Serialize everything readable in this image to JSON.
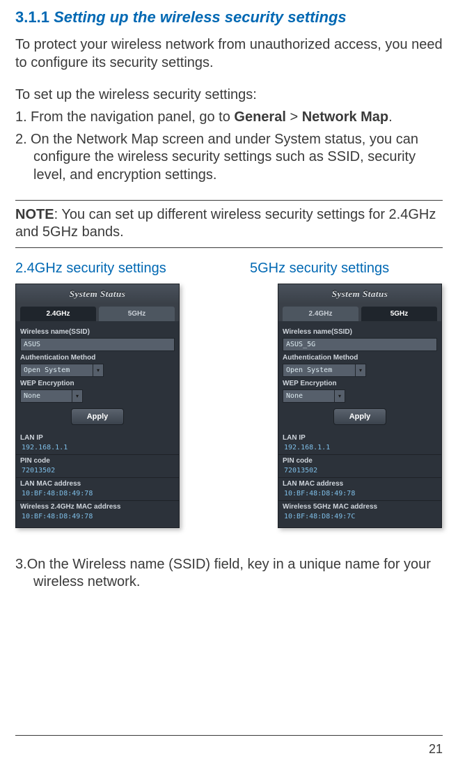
{
  "heading": {
    "number": "3.1.1",
    "title": "Setting up the wireless security settings"
  },
  "intro": "To protect your wireless network from unauthorized access, you need to configure its security settings.",
  "setup_lead": "To set up the wireless security settings:",
  "steps": {
    "s1_prefix": "1.",
    "s1_a": "From the navigation panel, go to ",
    "s1_b": "General",
    "s1_c": " > ",
    "s1_d": "Network Map",
    "s1_e": ".",
    "s2_prefix": "2.",
    "s2": "On the Network Map screen and under System status, you can configure the wireless security settings such as SSID, security level, and encryption settings."
  },
  "note": {
    "label": "NOTE",
    "text": ": You can set up different wireless security settings for 2.4GHz and 5GHz bands."
  },
  "captions": {
    "left": "2.4GHz security settings",
    "right": "5GHz security settings"
  },
  "panel": {
    "title": "System Status",
    "tabs": {
      "g24": "2.4GHz",
      "g5": "5GHz"
    },
    "labels": {
      "ssid": "Wireless name(SSID)",
      "auth": "Authentication Method",
      "wep": "WEP Encryption",
      "apply": "Apply",
      "lanip": "LAN IP",
      "pin": "PIN code",
      "lanmac": "LAN MAC address",
      "wmac24": "Wireless 2.4GHz MAC address",
      "wmac5": "Wireless 5GHz MAC address"
    },
    "left": {
      "ssid": "ASUS",
      "auth": "Open System",
      "wep": "None",
      "lanip": "192.168.1.1",
      "pin": "72013502",
      "lanmac": "10:BF:48:D8:49:78",
      "wmac": "10:BF:48:D8:49:78"
    },
    "right": {
      "ssid": "ASUS_5G",
      "auth": "Open System",
      "wep": "None",
      "lanip": "192.168.1.1",
      "pin": "72013502",
      "lanmac": "10:BF:48:D8:49:78",
      "wmac": "10:BF:48:D8:49:7C"
    }
  },
  "step3": {
    "prefix": "3.",
    "text": "On the Wireless name (SSID) field, key in a unique name for your wireless network."
  },
  "page": "21"
}
